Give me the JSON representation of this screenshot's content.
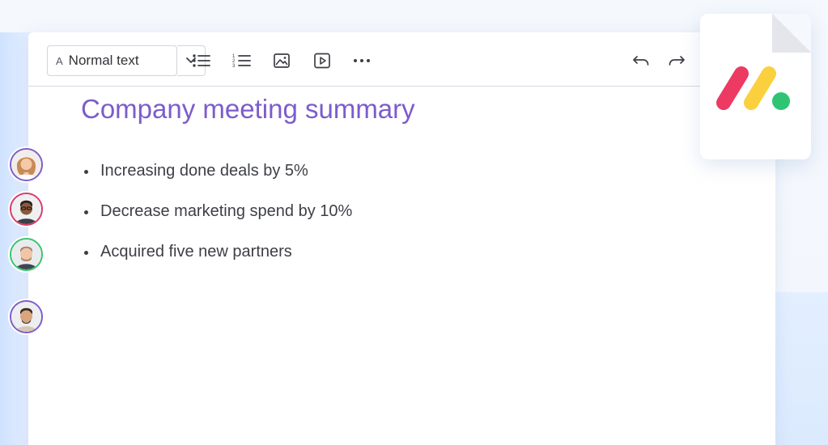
{
  "toolbar": {
    "text_style_icon": "A",
    "text_style_value": "Normal text",
    "icons": [
      "chevron-down-icon",
      "bulleted-list-icon",
      "numbered-list-icon",
      "image-icon",
      "video-icon",
      "more-icon",
      "undo-icon",
      "redo-icon"
    ]
  },
  "document": {
    "title": "Company meeting summary",
    "bullets": [
      "Increasing done deals by 5%",
      "Decrease marketing spend by 10%",
      "Acquired five new partners"
    ]
  },
  "collaborators": [
    {
      "ring_color": "#7c5ccb"
    },
    {
      "ring_color": "#d83a6a"
    },
    {
      "ring_color": "#38c46e"
    },
    {
      "ring_color": "#7c5ccb"
    }
  ],
  "brand": {
    "logo": "monday-logo",
    "colors": [
      "#ec3a63",
      "#fbd03f",
      "#2fc474"
    ]
  },
  "colors": {
    "title": "#7c5ccb",
    "text": "#3d3f45"
  }
}
